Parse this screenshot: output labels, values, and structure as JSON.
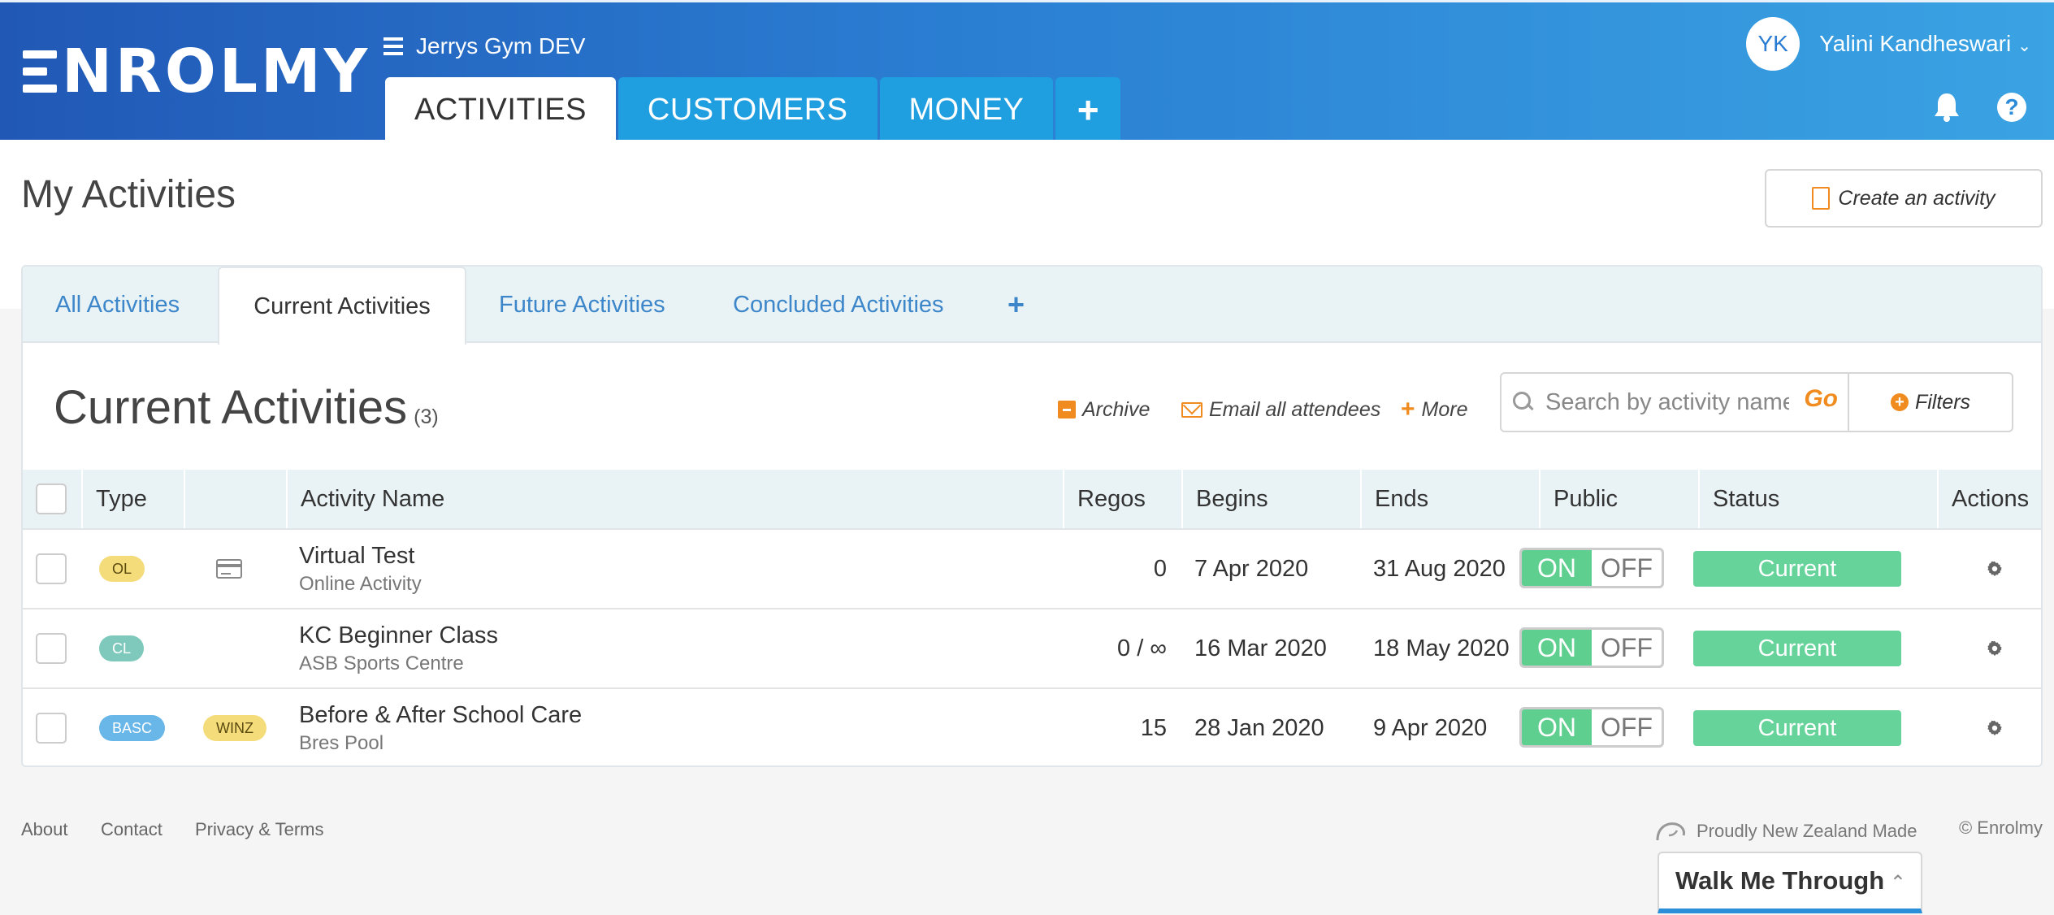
{
  "brand": {
    "logo_text": "NROLMY"
  },
  "org": {
    "name": "Jerrys Gym DEV"
  },
  "main_tabs": [
    {
      "label": "ACTIVITIES",
      "active": true
    },
    {
      "label": "CUSTOMERS",
      "active": false
    },
    {
      "label": "MONEY",
      "active": false
    },
    {
      "label": "+",
      "active": false
    }
  ],
  "user": {
    "initials": "YK",
    "name": "Yalini Kandheswari"
  },
  "icons": {
    "bell": "bell-icon",
    "help": "help-icon",
    "help_glyph": "?"
  },
  "page": {
    "title": "My Activities",
    "create_label": "Create an activity"
  },
  "subtabs": [
    {
      "label": "All Activities",
      "active": false
    },
    {
      "label": "Current Activities",
      "active": true
    },
    {
      "label": "Future Activities",
      "active": false
    },
    {
      "label": "Concluded Activities",
      "active": false
    }
  ],
  "subtab_add": "+",
  "section": {
    "title": "Current Activities",
    "count": "(3)"
  },
  "toolbar": {
    "archive": "Archive",
    "email": "Email all attendees",
    "more": "More",
    "search_placeholder": "Search by activity name",
    "go": "Go",
    "filters": "Filters"
  },
  "table": {
    "columns": [
      "Type",
      "",
      "Activity Name",
      "Regos",
      "Begins",
      "Ends",
      "Public",
      "Status",
      "Actions"
    ],
    "rows": [
      {
        "type": "OL",
        "type2": "",
        "has_card": true,
        "name": "Virtual Test",
        "location": "Online Activity",
        "regos": "0",
        "begins": "7 Apr 2020",
        "ends": "31 Aug 2020",
        "public_on": "ON",
        "public_off": "OFF",
        "status": "Current"
      },
      {
        "type": "CL",
        "type2": "",
        "has_card": false,
        "name": "KC Beginner Class",
        "location": "ASB Sports Centre",
        "regos": "0 / ∞",
        "begins": "16 Mar 2020",
        "ends": "18 May 2020",
        "public_on": "ON",
        "public_off": "OFF",
        "status": "Current"
      },
      {
        "type": "BASC",
        "type2": "WINZ",
        "has_card": false,
        "name": "Before & After School Care",
        "location": "Bres Pool",
        "regos": "15",
        "begins": "28 Jan 2020",
        "ends": "9 Apr 2020",
        "public_on": "ON",
        "public_off": "OFF",
        "status": "Current"
      }
    ]
  },
  "badge_colors": {
    "OL": "#f4dc7a",
    "CL": "#7ec9bb",
    "BASC": "#69b6e8",
    "WINZ": "#f4dc7a"
  },
  "footer": {
    "links": [
      "About",
      "Contact",
      "Privacy & Terms"
    ],
    "made_in": "Proudly New Zealand Made",
    "copyright": "© Enrolmy",
    "walk_me": "Walk Me Through"
  }
}
